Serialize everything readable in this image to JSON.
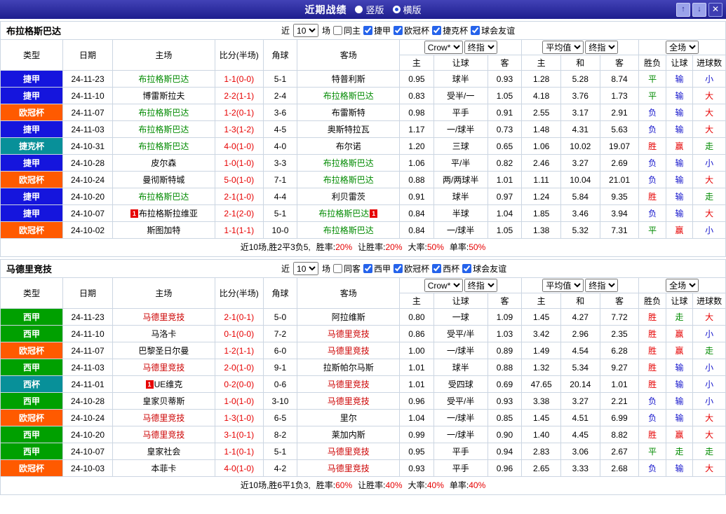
{
  "titlebar": {
    "title": "近期战绩",
    "layout_options": [
      {
        "label": "竖版",
        "selected": false
      },
      {
        "label": "横版",
        "selected": true
      }
    ],
    "buttons": {
      "up": "↑",
      "down": "↓",
      "close": "✕"
    }
  },
  "columns": {
    "type": "类型",
    "date": "日期",
    "home": "主场",
    "score": "比分(半场)",
    "corner": "角球",
    "away": "客场",
    "odds_sub": [
      "主",
      "让球",
      "客"
    ],
    "avg_sub": [
      "主",
      "和",
      "客"
    ],
    "result_sub": [
      "胜负",
      "让球",
      "进球数"
    ],
    "selects": {
      "source": "Crow*",
      "source_time": "终指",
      "avg": "平均值",
      "avg_time": "终指",
      "scope": "全场"
    }
  },
  "colors": {
    "titlebar_bg": "#2a2a9e",
    "score": "#e60000",
    "leagues": {
      "捷甲": "#1515dd",
      "欧冠杯": "#ff5a00",
      "捷克杯": "#089099",
      "西甲": "#00a000",
      "西杯": "#089099"
    },
    "result_map": {
      "胜": "#e60000",
      "平": "#008a00",
      "负": "#1515cc",
      "赢": "#e60000",
      "输": "#1515cc",
      "走": "#008a00",
      "大": "#e60000",
      "小": "#1515cc"
    }
  },
  "sections": [
    {
      "team": "布拉格斯巴达",
      "team_color": "#008a00",
      "filter": {
        "near": "近",
        "count": "10",
        "games": "场",
        "same": {
          "label": "同主",
          "checked": false
        },
        "leagues": [
          {
            "label": "捷甲",
            "checked": true
          },
          {
            "label": "欧冠杯",
            "checked": true
          },
          {
            "label": "捷克杯",
            "checked": true
          },
          {
            "label": "球会友谊",
            "checked": true
          }
        ]
      },
      "rows": [
        {
          "league": "捷甲",
          "date": "24-11-23",
          "home": "布拉格斯巴达",
          "home_hl": true,
          "home_badge": "",
          "score": "1-1(0-0)",
          "corner": "5-1",
          "away": "特普利斯",
          "away_hl": false,
          "away_badge": "",
          "odds": [
            "0.95",
            "球半",
            "0.93"
          ],
          "avg": [
            "1.28",
            "5.28",
            "8.74"
          ],
          "results": [
            "平",
            "输",
            "小"
          ]
        },
        {
          "league": "捷甲",
          "date": "24-11-10",
          "home": "博雷斯拉夫",
          "home_hl": false,
          "home_badge": "",
          "score": "2-2(1-1)",
          "corner": "2-4",
          "away": "布拉格斯巴达",
          "away_hl": true,
          "away_badge": "",
          "odds": [
            "0.83",
            "受半/一",
            "1.05"
          ],
          "avg": [
            "4.18",
            "3.76",
            "1.73"
          ],
          "results": [
            "平",
            "输",
            "大"
          ]
        },
        {
          "league": "欧冠杯",
          "date": "24-11-07",
          "home": "布拉格斯巴达",
          "home_hl": true,
          "home_badge": "",
          "score": "1-2(0-1)",
          "corner": "3-6",
          "away": "布雷斯特",
          "away_hl": false,
          "away_badge": "",
          "odds": [
            "0.98",
            "平手",
            "0.91"
          ],
          "avg": [
            "2.55",
            "3.17",
            "2.91"
          ],
          "results": [
            "负",
            "输",
            "大"
          ]
        },
        {
          "league": "捷甲",
          "date": "24-11-03",
          "home": "布拉格斯巴达",
          "home_hl": true,
          "home_badge": "",
          "score": "1-3(1-2)",
          "corner": "4-5",
          "away": "奥斯特拉瓦",
          "away_hl": false,
          "away_badge": "",
          "odds": [
            "1.17",
            "一/球半",
            "0.73"
          ],
          "avg": [
            "1.48",
            "4.31",
            "5.63"
          ],
          "results": [
            "负",
            "输",
            "大"
          ]
        },
        {
          "league": "捷克杯",
          "date": "24-10-31",
          "home": "布拉格斯巴达",
          "home_hl": true,
          "home_badge": "",
          "score": "4-0(1-0)",
          "corner": "4-0",
          "away": "布尔诺",
          "away_hl": false,
          "away_badge": "",
          "odds": [
            "1.20",
            "三球",
            "0.65"
          ],
          "avg": [
            "1.06",
            "10.02",
            "19.07"
          ],
          "results": [
            "胜",
            "赢",
            "走"
          ]
        },
        {
          "league": "捷甲",
          "date": "24-10-28",
          "home": "皮尔森",
          "home_hl": false,
          "home_badge": "",
          "score": "1-0(1-0)",
          "corner": "3-3",
          "away": "布拉格斯巴达",
          "away_hl": true,
          "away_badge": "",
          "odds": [
            "1.06",
            "平/半",
            "0.82"
          ],
          "avg": [
            "2.46",
            "3.27",
            "2.69"
          ],
          "results": [
            "负",
            "输",
            "小"
          ]
        },
        {
          "league": "欧冠杯",
          "date": "24-10-24",
          "home": "曼彻斯特城",
          "home_hl": false,
          "home_badge": "",
          "score": "5-0(1-0)",
          "corner": "7-1",
          "away": "布拉格斯巴达",
          "away_hl": true,
          "away_badge": "",
          "odds": [
            "0.88",
            "两/两球半",
            "1.01"
          ],
          "avg": [
            "1.11",
            "10.04",
            "21.01"
          ],
          "results": [
            "负",
            "输",
            "大"
          ]
        },
        {
          "league": "捷甲",
          "date": "24-10-20",
          "home": "布拉格斯巴达",
          "home_hl": true,
          "home_badge": "",
          "score": "2-1(1-0)",
          "corner": "4-4",
          "away": "利贝雷茨",
          "away_hl": false,
          "away_badge": "",
          "odds": [
            "0.91",
            "球半",
            "0.97"
          ],
          "avg": [
            "1.24",
            "5.84",
            "9.35"
          ],
          "results": [
            "胜",
            "输",
            "走"
          ]
        },
        {
          "league": "捷甲",
          "date": "24-10-07",
          "home": "布拉格斯拉维亚",
          "home_hl": false,
          "home_badge": "before",
          "score": "2-1(2-0)",
          "corner": "5-1",
          "away": "布拉格斯巴达",
          "away_hl": true,
          "away_badge": "after",
          "odds": [
            "0.84",
            "半球",
            "1.04"
          ],
          "avg": [
            "1.85",
            "3.46",
            "3.94"
          ],
          "results": [
            "负",
            "输",
            "大"
          ]
        },
        {
          "league": "欧冠杯",
          "date": "24-10-02",
          "home": "斯图加特",
          "home_hl": false,
          "home_badge": "",
          "score": "1-1(1-1)",
          "corner": "10-0",
          "away": "布拉格斯巴达",
          "away_hl": true,
          "away_badge": "",
          "odds": [
            "0.84",
            "一/球半",
            "1.05"
          ],
          "avg": [
            "1.38",
            "5.32",
            "7.31"
          ],
          "results": [
            "平",
            "赢",
            "小"
          ]
        }
      ],
      "summary": {
        "prefix": "近10场,胜2平3负5,",
        "stats": [
          {
            "label": "胜率:",
            "value": "20%"
          },
          {
            "label": "让胜率:",
            "value": "20%"
          },
          {
            "label": "大率:",
            "value": "50%"
          },
          {
            "label": "单率:",
            "value": "50%"
          }
        ]
      }
    },
    {
      "team": "马德里竞技",
      "team_color": "#cc0000",
      "filter": {
        "near": "近",
        "count": "10",
        "games": "场",
        "same": {
          "label": "同客",
          "checked": false
        },
        "leagues": [
          {
            "label": "西甲",
            "checked": true
          },
          {
            "label": "欧冠杯",
            "checked": true
          },
          {
            "label": "西杯",
            "checked": true
          },
          {
            "label": "球会友谊",
            "checked": true
          }
        ]
      },
      "rows": [
        {
          "league": "西甲",
          "date": "24-11-23",
          "home": "马德里竞技",
          "home_hl": true,
          "home_badge": "",
          "score": "2-1(0-1)",
          "corner": "5-0",
          "away": "阿拉维斯",
          "away_hl": false,
          "away_badge": "",
          "odds": [
            "0.80",
            "一球",
            "1.09"
          ],
          "avg": [
            "1.45",
            "4.27",
            "7.72"
          ],
          "results": [
            "胜",
            "走",
            "大"
          ]
        },
        {
          "league": "西甲",
          "date": "24-11-10",
          "home": "马洛卡",
          "home_hl": false,
          "home_badge": "",
          "score": "0-1(0-0)",
          "corner": "7-2",
          "away": "马德里竞技",
          "away_hl": true,
          "away_badge": "",
          "odds": [
            "0.86",
            "受平/半",
            "1.03"
          ],
          "avg": [
            "3.42",
            "2.96",
            "2.35"
          ],
          "results": [
            "胜",
            "赢",
            "小"
          ]
        },
        {
          "league": "欧冠杯",
          "date": "24-11-07",
          "home": "巴黎圣日尔曼",
          "home_hl": false,
          "home_badge": "",
          "score": "1-2(1-1)",
          "corner": "6-0",
          "away": "马德里竞技",
          "away_hl": true,
          "away_badge": "",
          "odds": [
            "1.00",
            "一/球半",
            "0.89"
          ],
          "avg": [
            "1.49",
            "4.54",
            "6.28"
          ],
          "results": [
            "胜",
            "赢",
            "走"
          ]
        },
        {
          "league": "西甲",
          "date": "24-11-03",
          "home": "马德里竞技",
          "home_hl": true,
          "home_badge": "",
          "score": "2-0(1-0)",
          "corner": "9-1",
          "away": "拉斯帕尔马斯",
          "away_hl": false,
          "away_badge": "",
          "odds": [
            "1.01",
            "球半",
            "0.88"
          ],
          "avg": [
            "1.32",
            "5.34",
            "9.27"
          ],
          "results": [
            "胜",
            "输",
            "小"
          ]
        },
        {
          "league": "西杯",
          "date": "24-11-01",
          "home": "UE维克",
          "home_hl": false,
          "home_badge": "before",
          "score": "0-2(0-0)",
          "corner": "0-6",
          "away": "马德里竞技",
          "away_hl": true,
          "away_badge": "",
          "odds": [
            "1.01",
            "受四球",
            "0.69"
          ],
          "avg": [
            "47.65",
            "20.14",
            "1.01"
          ],
          "results": [
            "胜",
            "输",
            "小"
          ]
        },
        {
          "league": "西甲",
          "date": "24-10-28",
          "home": "皇家贝蒂斯",
          "home_hl": false,
          "home_badge": "",
          "score": "1-0(1-0)",
          "corner": "3-10",
          "away": "马德里竞技",
          "away_hl": true,
          "away_badge": "",
          "odds": [
            "0.96",
            "受平/半",
            "0.93"
          ],
          "avg": [
            "3.38",
            "3.27",
            "2.21"
          ],
          "results": [
            "负",
            "输",
            "小"
          ]
        },
        {
          "league": "欧冠杯",
          "date": "24-10-24",
          "home": "马德里竞技",
          "home_hl": true,
          "home_badge": "",
          "score": "1-3(1-0)",
          "corner": "6-5",
          "away": "里尔",
          "away_hl": false,
          "away_badge": "",
          "odds": [
            "1.04",
            "一/球半",
            "0.85"
          ],
          "avg": [
            "1.45",
            "4.51",
            "6.99"
          ],
          "results": [
            "负",
            "输",
            "大"
          ]
        },
        {
          "league": "西甲",
          "date": "24-10-20",
          "home": "马德里竞技",
          "home_hl": true,
          "home_badge": "",
          "score": "3-1(0-1)",
          "corner": "8-2",
          "away": "莱加内斯",
          "away_hl": false,
          "away_badge": "",
          "odds": [
            "0.99",
            "一/球半",
            "0.90"
          ],
          "avg": [
            "1.40",
            "4.45",
            "8.82"
          ],
          "results": [
            "胜",
            "赢",
            "大"
          ]
        },
        {
          "league": "西甲",
          "date": "24-10-07",
          "home": "皇家社会",
          "home_hl": false,
          "home_badge": "",
          "score": "1-1(0-1)",
          "corner": "5-1",
          "away": "马德里竞技",
          "away_hl": true,
          "away_badge": "",
          "odds": [
            "0.95",
            "平手",
            "0.94"
          ],
          "avg": [
            "2.83",
            "3.06",
            "2.67"
          ],
          "results": [
            "平",
            "走",
            "走"
          ]
        },
        {
          "league": "欧冠杯",
          "date": "24-10-03",
          "home": "本菲卡",
          "home_hl": false,
          "home_badge": "",
          "score": "4-0(1-0)",
          "corner": "4-2",
          "away": "马德里竞技",
          "away_hl": true,
          "away_badge": "",
          "odds": [
            "0.93",
            "平手",
            "0.96"
          ],
          "avg": [
            "2.65",
            "3.33",
            "2.68"
          ],
          "results": [
            "负",
            "输",
            "大"
          ]
        }
      ],
      "summary": {
        "prefix": "近10场,胜6平1负3,",
        "stats": [
          {
            "label": "胜率:",
            "value": "60%"
          },
          {
            "label": "让胜率:",
            "value": "40%"
          },
          {
            "label": "大率:",
            "value": "40%"
          },
          {
            "label": "单率:",
            "value": "40%"
          }
        ]
      }
    }
  ]
}
